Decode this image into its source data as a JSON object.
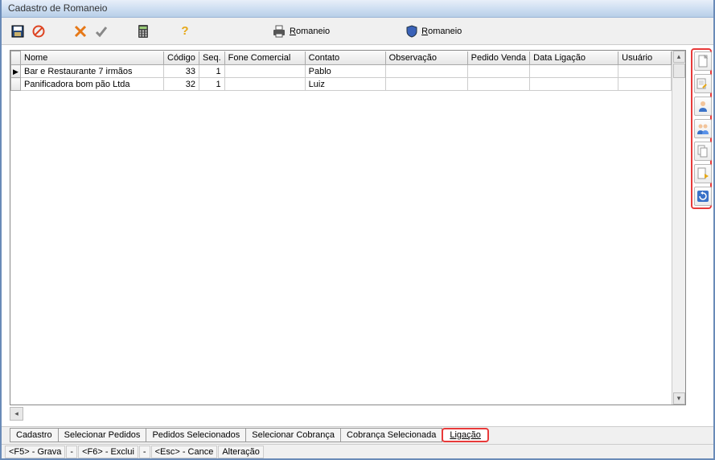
{
  "window": {
    "title": "Cadastro de Romaneio"
  },
  "toolbar": {
    "romaneio1": "Romaneio",
    "romaneio2": "Romaneio"
  },
  "grid": {
    "headers": [
      "Nome",
      "Código",
      "Seq.",
      "Fone Comercial",
      "Contato",
      "Observação",
      "Pedido Venda",
      "Data Ligação",
      "Usuário"
    ],
    "rows": [
      {
        "selected": true,
        "nome": "Bar e Restaurante 7 irmãos",
        "codigo": "33",
        "seq": "1",
        "fone": "",
        "contato": "Pablo",
        "obs": "",
        "pedido": "",
        "data": "",
        "usuario": ""
      },
      {
        "selected": false,
        "nome": "Panificadora bom pão Ltda",
        "codigo": "32",
        "seq": "1",
        "fone": "",
        "contato": "Luiz",
        "obs": "",
        "pedido": "",
        "data": "",
        "usuario": ""
      }
    ]
  },
  "tabs": {
    "items": [
      "Cadastro",
      "Selecionar Pedidos",
      "Pedidos Selecionados",
      "Selecionar Cobrança",
      "Cobrança Selecionada",
      "Ligação"
    ],
    "active_index": 5
  },
  "status": {
    "f5": "<F5> - Grava",
    "dash1": "-",
    "f6": "<F6> - Exclui",
    "dash2": "-",
    "esc": "<Esc> - Cance",
    "mode": "Alteração"
  },
  "icons": {
    "save": "save-icon",
    "deny": "deny-icon",
    "delete": "delete-icon",
    "confirm": "confirm-icon",
    "calc": "calculator-icon",
    "help": "help-icon",
    "printer": "printer-icon",
    "shield": "shield-icon",
    "right_panel": [
      "new-doc-icon",
      "edit-doc-icon",
      "user-icon",
      "users-icon",
      "copy-doc-icon",
      "export-doc-icon",
      "refresh-icon"
    ]
  }
}
